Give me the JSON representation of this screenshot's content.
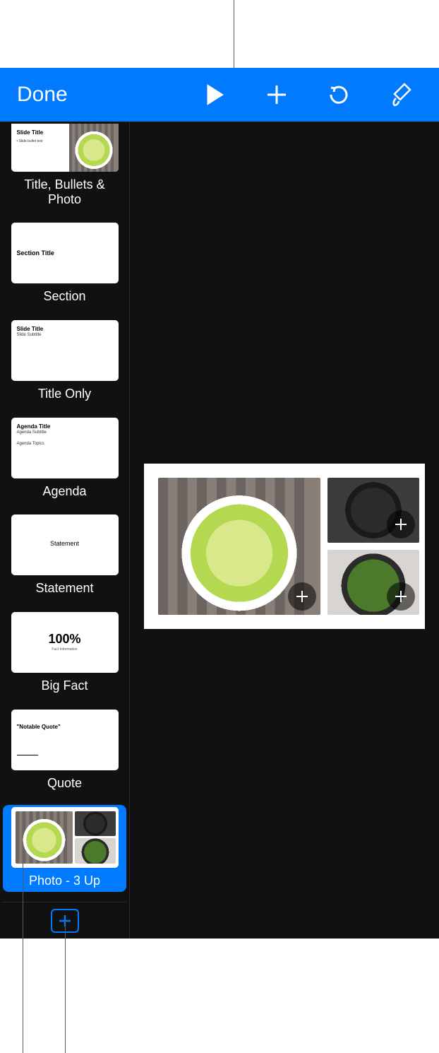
{
  "toolbar": {
    "done_label": "Done",
    "play_icon": "play-icon",
    "add_icon": "plus-icon",
    "undo_icon": "undo-icon",
    "format_icon": "paintbrush-icon"
  },
  "layouts": [
    {
      "label": "Title, Bullets & Photo",
      "thumb_title": "Slide Title",
      "thumb_sub": "• Slide bullet text"
    },
    {
      "label": "Section",
      "thumb_title": "Section Title",
      "thumb_sub": ""
    },
    {
      "label": "Title Only",
      "thumb_title": "Slide Title",
      "thumb_sub": "Slide Subtitle"
    },
    {
      "label": "Agenda",
      "thumb_title": "Agenda Title",
      "thumb_sub": "Agenda Subtitle",
      "thumb_extra": "Agenda Topics"
    },
    {
      "label": "Statement",
      "thumb_center": "Statement"
    },
    {
      "label": "Big Fact",
      "thumb_center": "100%",
      "thumb_center_sub": "Fact Information"
    },
    {
      "label": "Quote",
      "thumb_quote": "\"Notable Quote\""
    },
    {
      "label": "Photo - 3 Up"
    }
  ],
  "selected_layout_index": 7,
  "add_slide_label": "Add Slide",
  "canvas": {
    "placeholders": [
      {
        "name": "photo-large",
        "add": true
      },
      {
        "name": "photo-top-right",
        "add": true
      },
      {
        "name": "photo-bottom-right",
        "add": true
      }
    ]
  }
}
